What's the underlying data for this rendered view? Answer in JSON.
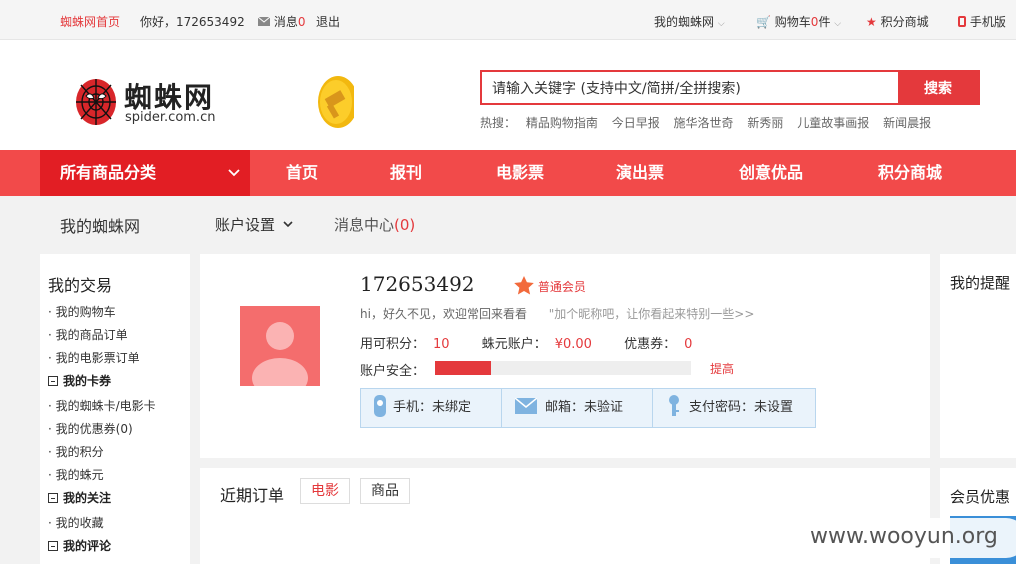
{
  "topbar": {
    "home": "蜘蛛网首页",
    "greeting": "你好，172653492",
    "messages_label": "消息",
    "messages_count": "0",
    "logout": "退出",
    "my_spider": "我的蜘蛛网",
    "cart_label": "购物车",
    "cart_count": "0",
    "cart_unit": "件",
    "points_mall": "积分商城",
    "mobile": "手机版"
  },
  "header": {
    "logo_cn": "蜘蛛网",
    "logo_en": "spider.com.cn",
    "search": {
      "value": "请输入关键字 (支持中文/简拼/全拼搜索)",
      "button": "搜索"
    },
    "hot_label": "热搜：",
    "hot_items": [
      "精品购物指南",
      "今日早报",
      "施华洛世奇",
      "新秀丽",
      "儿童故事画报",
      "新闻晨报"
    ]
  },
  "nav": {
    "all_categories": "所有商品分类",
    "links": [
      "首页",
      "报刊",
      "电影票",
      "演出票",
      "创意优品",
      "积分商城"
    ]
  },
  "subnav": {
    "my_spider": "我的蜘蛛网",
    "account_settings": "账户设置",
    "message_center": "消息中心",
    "message_count": "(0)"
  },
  "sidebar": {
    "title": "我的交易",
    "trade_items": [
      "我的购物车",
      "我的商品订单",
      "我的电影票订单"
    ],
    "cards_title": "我的卡券",
    "cards_items": [
      "我的蜘蛛卡/电影卡",
      "我的优惠券(0)",
      "我的积分",
      "我的蛛元"
    ],
    "follow_title": "我的关注",
    "follow_items": [
      "我的收藏"
    ],
    "comments_title": "我的评论"
  },
  "profile": {
    "username": "172653492",
    "member_level": "普通会员",
    "greeting": "hi，好久不见，欢迎常回来看看",
    "nickname_prompt": "\"加个昵称吧，让你看起来特别一些>>",
    "points_label": "用可积分：",
    "points_value": "10",
    "zhuyuan_label": "蛛元账户：",
    "zhuyuan_value": "¥0.00",
    "coupon_label": "优惠券：",
    "coupon_value": "0",
    "security_label": "账户安全：",
    "security_level": 0.22,
    "improve": "提高",
    "phone": "手机：未绑定",
    "email": "邮箱：未验证",
    "paypass": "支付密码：未设置"
  },
  "orders": {
    "title": "近期订单",
    "tabs": [
      "电影",
      "商品"
    ]
  },
  "right": {
    "reminder": "我的提醒",
    "member_benefit": "会员优惠"
  },
  "watermark": "www.wooyun.org",
  "colors": {
    "brand_red": "#e4393c",
    "nav_red": "#f24a4a",
    "nav_dark": "#e21e24"
  }
}
